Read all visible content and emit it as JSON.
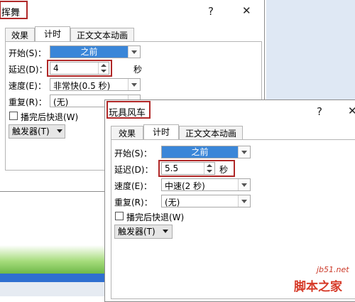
{
  "colors": {
    "accent": "#3a86d8",
    "highlight": "#b02828",
    "grass": "#8ed06a",
    "strip": "#2f6fd0"
  },
  "back": {
    "title": "挥舞",
    "help": "?",
    "close": "✕",
    "tabs": [
      "效果",
      "计时",
      "正文文本动画"
    ],
    "start_label": "开始(S)：",
    "start_value": "之前",
    "delay_label": "延迟(D)：",
    "delay_value": "4",
    "delay_unit": "秒",
    "speed_label": "速度(E)：",
    "speed_value": "非常快(0.5 秒)",
    "repeat_label": "重复(R)：",
    "repeat_value": "(无)",
    "rewind_label": "播完后快退(W)",
    "trigger_label": "触发器(T)"
  },
  "front": {
    "title": "玩具风车",
    "help": "?",
    "close": "✕",
    "tabs": [
      "效果",
      "计时",
      "正文文本动画"
    ],
    "start_label": "开始(S)：",
    "start_value": "之前",
    "delay_label": "延迟(D)：",
    "delay_value": "5.5",
    "delay_unit": "秒",
    "speed_label": "速度(E)：",
    "speed_value": "中速(2 秒)",
    "repeat_label": "重复(R)：",
    "repeat_value": "(无)",
    "rewind_label": "播完后快退(W)",
    "trigger_label": "触发器(T)"
  },
  "watermark": {
    "site": "jb51.net",
    "name": "脚本之家"
  }
}
